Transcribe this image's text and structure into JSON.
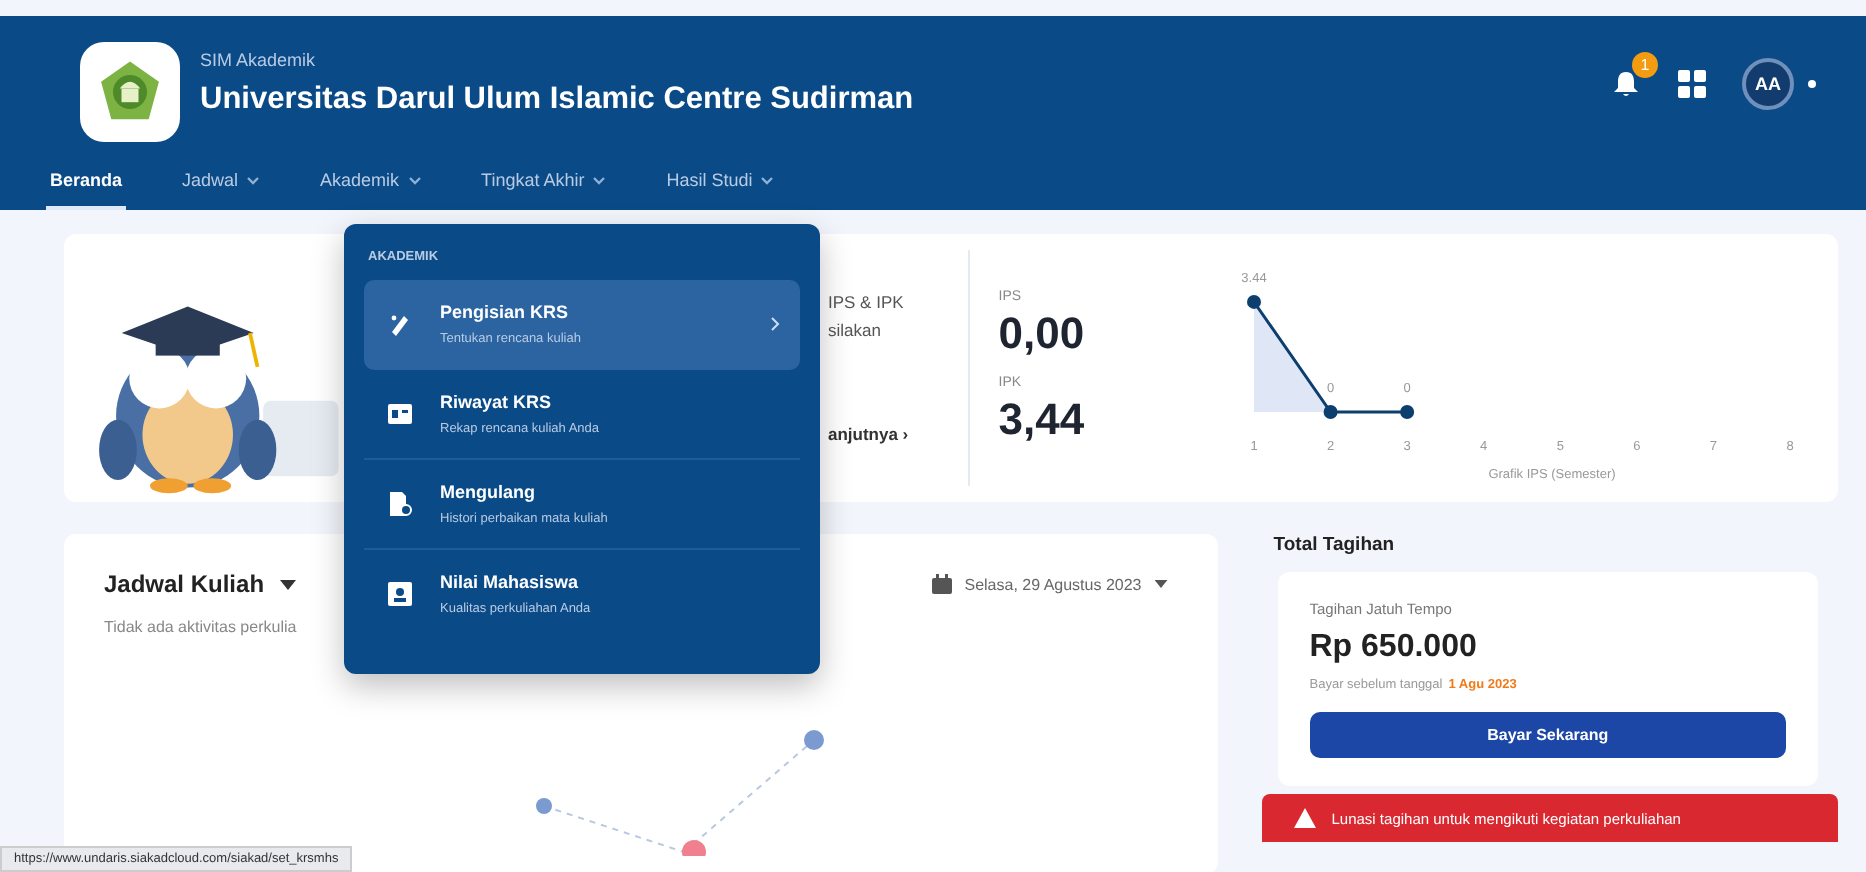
{
  "header": {
    "app_name": "SIM Akademik",
    "university": "Universitas Darul Ulum Islamic Centre Sudirman",
    "notification_count": "1",
    "avatar_initials": "AA"
  },
  "nav": [
    {
      "label": "Beranda",
      "selected": true,
      "dropdown": false
    },
    {
      "label": "Jadwal",
      "selected": false,
      "dropdown": true
    },
    {
      "label": "Akademik",
      "selected": false,
      "dropdown": true
    },
    {
      "label": "Tingkat Akhir",
      "selected": false,
      "dropdown": true
    },
    {
      "label": "Hasil Studi",
      "selected": false,
      "dropdown": true
    }
  ],
  "menu": {
    "heading": "AKADEMIK",
    "items": [
      {
        "title": "Pengisian KRS",
        "subtitle": "Tentukan rencana kuliah",
        "selected": true
      },
      {
        "title": "Riwayat KRS",
        "subtitle": "Rekap rencana kuliah Anda",
        "selected": false
      },
      {
        "title": "Mengulang",
        "subtitle": "Histori perbaikan mata kuliah",
        "selected": false
      },
      {
        "title": "Nilai Mahasiswa",
        "subtitle": "Kualitas perkuliahan Anda",
        "selected": false
      }
    ]
  },
  "welcome": {
    "lines": [
      "IPS & IPK",
      "silakan"
    ],
    "link": "anjutnya ›"
  },
  "scores": [
    {
      "label": "IPS",
      "value": "0,00"
    },
    {
      "label": "IPK",
      "value": "3,44"
    }
  ],
  "ips_chart": {
    "chart_data": {
      "type": "line",
      "xlabel": "Grafik IPS (Semester)",
      "categories": [
        "1",
        "2",
        "3",
        "4",
        "5",
        "6",
        "7",
        "8"
      ],
      "series": [
        {
          "color": "#0d3f6e",
          "marker": true,
          "values": [
            3.44,
            0,
            0,
            null,
            null,
            null,
            null,
            null
          ]
        }
      ],
      "data_labels": true
    }
  },
  "schedule": {
    "title": "Jadwal Kuliah",
    "empty_text": "Tidak ada aktivitas perkulia",
    "date": "Selasa, 29 Agustus 2023"
  },
  "billing": {
    "title": "Total Tagihan",
    "due_label": "Tagihan Jatuh Tempo",
    "amount": "Rp 650.000",
    "deadline_text": "Bayar sebelum tanggal",
    "deadline_date": "1 Agu 2023",
    "pay_button": "Bayar Sekarang",
    "alert": "Lunasi tagihan untuk mengikuti kegiatan perkuliahan"
  },
  "status_url": "https://www.undaris.siakadcloud.com/siakad/set_krsmhs"
}
